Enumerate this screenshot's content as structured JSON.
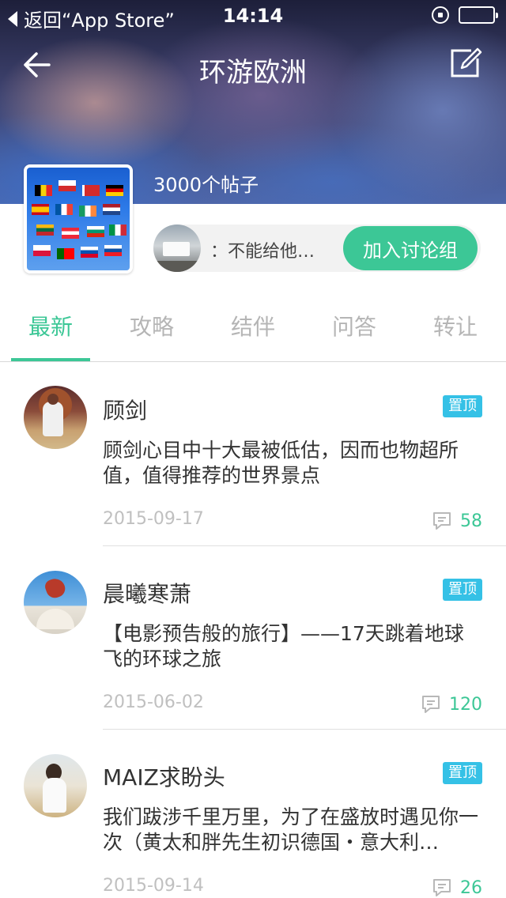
{
  "status_bar": {
    "back_label": "返回“App Store”",
    "time": "14:14"
  },
  "nav": {
    "title": "环游欧洲"
  },
  "group": {
    "post_count": "3000个帖子",
    "member_preview": "：不能给他…",
    "join_label": "加入讨论组"
  },
  "tabs": [
    {
      "label": "最新",
      "active": true
    },
    {
      "label": "攻略",
      "active": false
    },
    {
      "label": "结伴",
      "active": false
    },
    {
      "label": "问答",
      "active": false
    },
    {
      "label": "转让",
      "active": false
    }
  ],
  "posts": [
    {
      "author": "顾剑",
      "badge": "置顶",
      "text": "顾剑心目中十大最被低估，因而也物超所值，值得推荐的世界景点",
      "date": "2015-09-17",
      "comments": "58"
    },
    {
      "author": "晨曦寒萧",
      "badge": "置顶",
      "text": "【电影预告般的旅行】——17天跳着地球飞的环球之旅",
      "date": "2015-06-02",
      "comments": "120"
    },
    {
      "author": "MAIZ求盼头",
      "badge": "置顶",
      "text": "我们跋涉千里万里，为了在盛放时遇见你一次（黄太和胖先生初识德国・意大利…",
      "date": "2015-09-14",
      "comments": "26"
    }
  ],
  "colors": {
    "accent": "#3cc796",
    "badge": "#35c1e6"
  }
}
